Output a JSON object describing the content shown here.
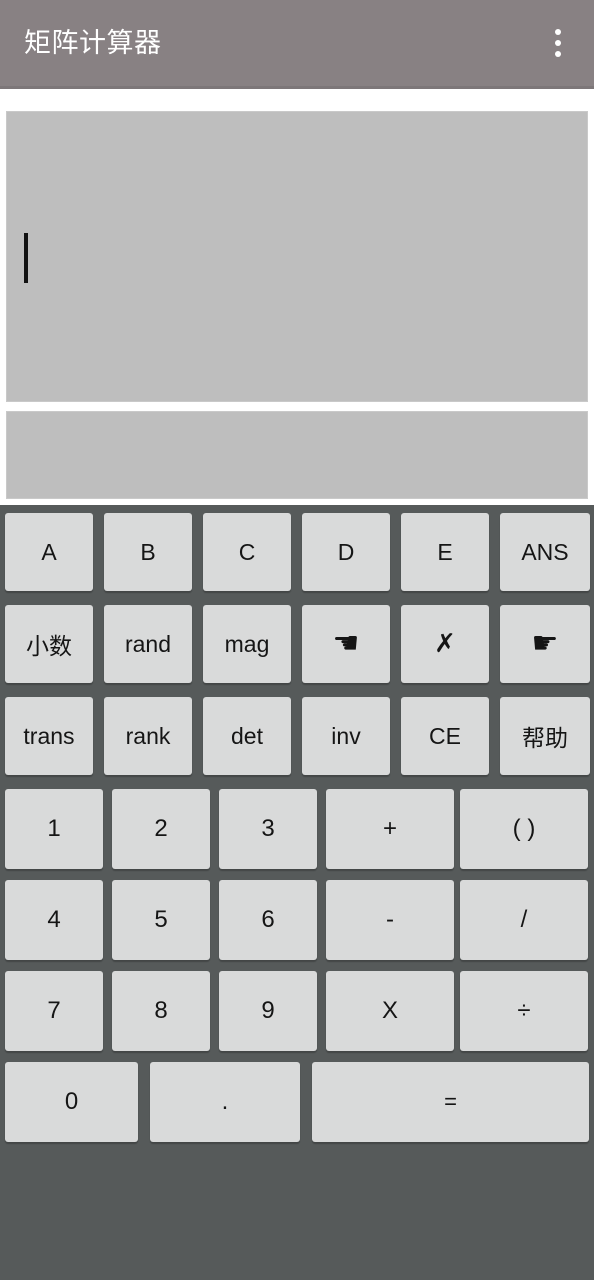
{
  "app": {
    "title": "矩阵计算器",
    "colors": {
      "titlebar": "#888183",
      "keypad_background": "#565a5a",
      "key_face": "#d9dada",
      "panel_fill": "#bebebe",
      "display_background": "#ffffff",
      "text": "#151515",
      "title_text": "#ffffff"
    }
  },
  "titlebar": {
    "title": "矩阵计算器",
    "overflow_icon": "overflow-menu-icon"
  },
  "display": {
    "input": {
      "value": "",
      "caret_visible": true
    },
    "result": {
      "value": ""
    }
  },
  "keypad": {
    "rows": [
      {
        "id": "row-matrix-vars",
        "columns": 6,
        "keys": [
          {
            "label": "A",
            "name": "key-a",
            "kind": "fn"
          },
          {
            "label": "B",
            "name": "key-b",
            "kind": "fn"
          },
          {
            "label": "C",
            "name": "key-c",
            "kind": "fn"
          },
          {
            "label": "D",
            "name": "key-d",
            "kind": "fn"
          },
          {
            "label": "E",
            "name": "key-e",
            "kind": "fn"
          },
          {
            "label": "ANS",
            "name": "key-ans",
            "kind": "fn"
          }
        ]
      },
      {
        "id": "row-tools",
        "columns": 6,
        "keys": [
          {
            "label": "小数",
            "name": "key-decimal-cjk",
            "kind": "cjk"
          },
          {
            "label": "rand",
            "name": "key-rand",
            "kind": "fn"
          },
          {
            "label": "mag",
            "name": "key-mag",
            "kind": "fn"
          },
          {
            "label": "☚",
            "name": "cursor-left-hand-icon",
            "kind": "hand"
          },
          {
            "label": "✗",
            "name": "backspace-cross-icon",
            "kind": "glyph"
          },
          {
            "label": "☛",
            "name": "cursor-right-hand-icon",
            "kind": "hand"
          }
        ]
      },
      {
        "id": "row-operations",
        "columns": 6,
        "keys": [
          {
            "label": "trans",
            "name": "key-trans",
            "kind": "fn"
          },
          {
            "label": "rank",
            "name": "key-rank",
            "kind": "fn"
          },
          {
            "label": "det",
            "name": "key-det",
            "kind": "fn"
          },
          {
            "label": "inv",
            "name": "key-inv",
            "kind": "fn"
          },
          {
            "label": "CE",
            "name": "key-ce",
            "kind": "fn"
          },
          {
            "label": "帮助",
            "name": "key-help",
            "kind": "cjk"
          }
        ]
      },
      {
        "id": "row-123",
        "columns": 5,
        "keys": [
          {
            "label": "1",
            "name": "key-1",
            "kind": "num"
          },
          {
            "label": "2",
            "name": "key-2",
            "kind": "num"
          },
          {
            "label": "3",
            "name": "key-3",
            "kind": "num"
          },
          {
            "label": "+",
            "name": "key-plus",
            "kind": "num"
          },
          {
            "label": "( )",
            "name": "key-parentheses",
            "kind": "num"
          }
        ]
      },
      {
        "id": "row-456",
        "columns": 5,
        "keys": [
          {
            "label": "4",
            "name": "key-4",
            "kind": "num"
          },
          {
            "label": "5",
            "name": "key-5",
            "kind": "num"
          },
          {
            "label": "6",
            "name": "key-6",
            "kind": "num"
          },
          {
            "label": "-",
            "name": "key-minus",
            "kind": "num"
          },
          {
            "label": "/",
            "name": "key-slash",
            "kind": "num"
          }
        ]
      },
      {
        "id": "row-789",
        "columns": 5,
        "keys": [
          {
            "label": "7",
            "name": "key-7",
            "kind": "num"
          },
          {
            "label": "8",
            "name": "key-8",
            "kind": "num"
          },
          {
            "label": "9",
            "name": "key-9",
            "kind": "num"
          },
          {
            "label": "X",
            "name": "key-multiply",
            "kind": "num"
          },
          {
            "label": "÷",
            "name": "key-divide",
            "kind": "num"
          }
        ]
      },
      {
        "id": "row-bottom",
        "columns": 3,
        "keys": [
          {
            "label": "0",
            "name": "key-0",
            "kind": "num"
          },
          {
            "label": ".",
            "name": "key-decimal",
            "kind": "num"
          },
          {
            "label": "=",
            "name": "key-equals",
            "kind": "equals"
          }
        ]
      }
    ]
  }
}
